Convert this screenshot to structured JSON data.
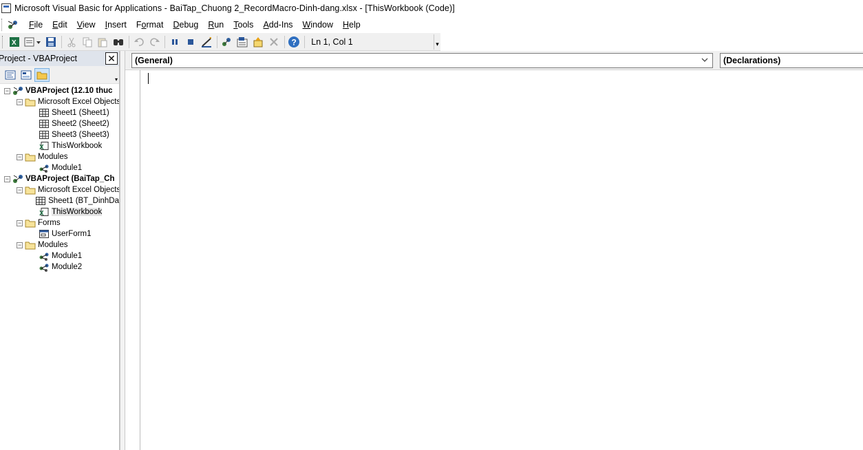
{
  "window": {
    "title": "Microsoft Visual Basic for Applications - BaiTap_Chuong 2_RecordMacro-Dinh-dang.xlsx - [ThisWorkbook (Code)]"
  },
  "menu": {
    "items": [
      {
        "label": "File",
        "accel": "F"
      },
      {
        "label": "Edit",
        "accel": "E"
      },
      {
        "label": "View",
        "accel": "V"
      },
      {
        "label": "Insert",
        "accel": "I"
      },
      {
        "label": "Format",
        "accel": "o"
      },
      {
        "label": "Debug",
        "accel": "D"
      },
      {
        "label": "Run",
        "accel": "R"
      },
      {
        "label": "Tools",
        "accel": "T"
      },
      {
        "label": "Add-Ins",
        "accel": "A"
      },
      {
        "label": "Window",
        "accel": "W"
      },
      {
        "label": "Help",
        "accel": "H"
      }
    ]
  },
  "toolbar": {
    "status": "Ln 1, Col 1",
    "icons": [
      "excel-view-icon",
      "insert-module-icon",
      "save-icon",
      "cut-icon",
      "copy-icon",
      "paste-icon",
      "find-icon",
      "undo-icon",
      "redo-icon",
      "run-icon",
      "break-icon",
      "reset-icon",
      "design-mode-icon",
      "project-explorer-icon",
      "properties-window-icon",
      "object-browser-icon",
      "toolbox-icon",
      "help-icon"
    ]
  },
  "project_pane": {
    "title": "Project - VBAProject",
    "tree": [
      {
        "label": "VBAProject (12.10 thuc",
        "level": 0,
        "type": "project",
        "bold": true
      },
      {
        "label": "Microsoft Excel Objects",
        "level": 1,
        "type": "folder"
      },
      {
        "label": "Sheet1 (Sheet1)",
        "level": 2,
        "type": "sheet"
      },
      {
        "label": "Sheet2 (Sheet2)",
        "level": 2,
        "type": "sheet"
      },
      {
        "label": "Sheet3 (Sheet3)",
        "level": 2,
        "type": "sheet"
      },
      {
        "label": "ThisWorkbook",
        "level": 2,
        "type": "workbook"
      },
      {
        "label": "Modules",
        "level": 1,
        "type": "folder"
      },
      {
        "label": "Module1",
        "level": 2,
        "type": "module"
      },
      {
        "label": "VBAProject (BaiTap_Ch",
        "level": 0,
        "type": "project",
        "bold": true
      },
      {
        "label": "Microsoft Excel Objects",
        "level": 1,
        "type": "folder"
      },
      {
        "label": "Sheet1 (BT_DinhDa",
        "level": 2,
        "type": "sheet"
      },
      {
        "label": "ThisWorkbook",
        "level": 2,
        "type": "workbook",
        "selected": true
      },
      {
        "label": "Forms",
        "level": 1,
        "type": "folder"
      },
      {
        "label": "UserForm1",
        "level": 2,
        "type": "form"
      },
      {
        "label": "Modules",
        "level": 1,
        "type": "folder"
      },
      {
        "label": "Module1",
        "level": 2,
        "type": "module"
      },
      {
        "label": "Module2",
        "level": 2,
        "type": "module"
      }
    ]
  },
  "code_window": {
    "object_combo": "(General)",
    "procedure_combo": "(Declarations)"
  }
}
